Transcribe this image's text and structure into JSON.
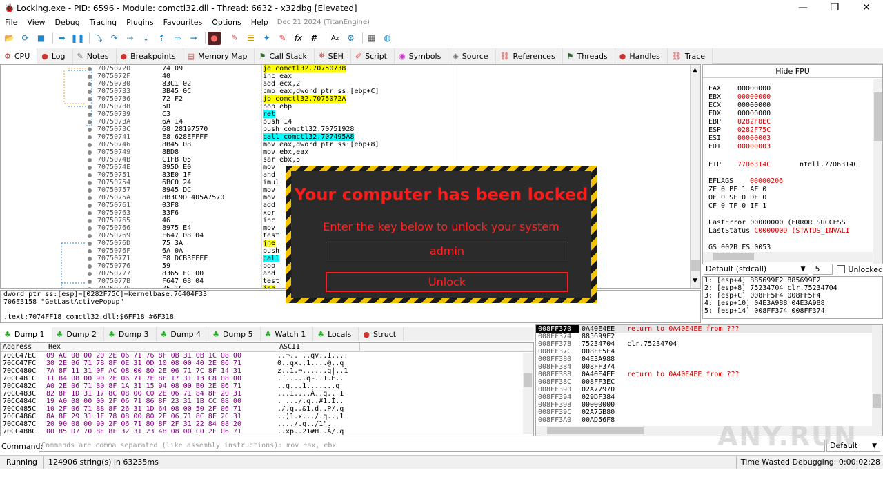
{
  "window": {
    "title": "Locking.exe - PID: 6596 - Module: comctl32.dll - Thread: 6632 - x32dbg [Elevated]",
    "min": "—",
    "max": "❐",
    "close": "✕"
  },
  "menu": {
    "items": [
      "File",
      "View",
      "Debug",
      "Tracing",
      "Plugins",
      "Favourites",
      "Options",
      "Help"
    ],
    "date": "Dec 21 2024 (TitanEngine)"
  },
  "tabs": [
    "CPU",
    "Log",
    "Notes",
    "Breakpoints",
    "Memory Map",
    "Call Stack",
    "SEH",
    "Script",
    "Symbols",
    "Source",
    "References",
    "Threads",
    "Handles",
    "Trace"
  ],
  "disasm": [
    {
      "addr": "70750720",
      "bytes": "74 09",
      "ins": "je comctl32.70750738",
      "hl": "y"
    },
    {
      "addr": "7075072F",
      "bytes": "40",
      "ins": "inc eax",
      "hl": ""
    },
    {
      "addr": "70750730",
      "bytes": "83C1 02",
      "ins": "add ecx,2",
      "hl": ""
    },
    {
      "addr": "70750733",
      "bytes": "3B45 0C",
      "ins": "cmp eax,dword ptr ss:[ebp+C]",
      "hl": ""
    },
    {
      "addr": "70750736",
      "bytes": "72 F2",
      "ins": "jb comctl32.7075072A",
      "hl": "y"
    },
    {
      "addr": "70750738",
      "bytes": "5D",
      "ins": "pop ebp",
      "hl": ""
    },
    {
      "addr": "70750739",
      "bytes": "C3",
      "ins": "ret",
      "hl": "c"
    },
    {
      "addr": "7075073A",
      "bytes": "6A 14",
      "ins": "push 14",
      "hl": ""
    },
    {
      "addr": "7075073C",
      "bytes": "68 28197570",
      "ins": "push comctl32.70751928",
      "hl": ""
    },
    {
      "addr": "70750741",
      "bytes": "E8 628EFFFF",
      "ins": "call comctl32.707495A8",
      "hl": "c"
    },
    {
      "addr": "70750746",
      "bytes": "8B45 08",
      "ins": "mov eax,dword ptr ss:[ebp+8]",
      "hl": ""
    },
    {
      "addr": "70750749",
      "bytes": "8BD8",
      "ins": "mov ebx,eax",
      "hl": ""
    },
    {
      "addr": "7075074B",
      "bytes": "C1FB 05",
      "ins": "sar ebx,5",
      "hl": ""
    },
    {
      "addr": "7075074E",
      "bytes": "895D E0",
      "ins": "mov",
      "hl": ""
    },
    {
      "addr": "70750751",
      "bytes": "83E0 1F",
      "ins": "and",
      "hl": ""
    },
    {
      "addr": "70750754",
      "bytes": "6BC0 24",
      "ins": "imul",
      "hl": ""
    },
    {
      "addr": "70750757",
      "bytes": "8945 DC",
      "ins": "mov",
      "hl": ""
    },
    {
      "addr": "7075075A",
      "bytes": "8B3C9D 405A7570",
      "ins": "mov",
      "hl": ""
    },
    {
      "addr": "70750761",
      "bytes": "03F8",
      "ins": "add",
      "hl": ""
    },
    {
      "addr": "70750763",
      "bytes": "33F6",
      "ins": "xor",
      "hl": ""
    },
    {
      "addr": "70750765",
      "bytes": "46",
      "ins": "inc",
      "hl": ""
    },
    {
      "addr": "70750766",
      "bytes": "8975 E4",
      "ins": "mov",
      "hl": ""
    },
    {
      "addr": "70750769",
      "bytes": "F647 08 04",
      "ins": "test",
      "hl": ""
    },
    {
      "addr": "7075076D",
      "bytes": "75 3A",
      "ins": "jne",
      "hl": "y"
    },
    {
      "addr": "7075076F",
      "bytes": "6A 0A",
      "ins": "push",
      "hl": ""
    },
    {
      "addr": "70750771",
      "bytes": "E8 DCB3FFFF",
      "ins": "call",
      "hl": "c"
    },
    {
      "addr": "70750776",
      "bytes": "59",
      "ins": "pop",
      "hl": ""
    },
    {
      "addr": "70750777",
      "bytes": "8365 FC 00",
      "ins": "and",
      "hl": ""
    },
    {
      "addr": "7075077B",
      "bytes": "F647 08 04",
      "ins": "test",
      "hl": ""
    },
    {
      "addr": "7075077F",
      "bytes": "75 1C",
      "ins": "jne",
      "hl": "y"
    }
  ],
  "registers": {
    "header": "Hide FPU",
    "gp": [
      {
        "n": "EAX",
        "v": "00000000",
        "red": false
      },
      {
        "n": "EBX",
        "v": "00000000",
        "red": true
      },
      {
        "n": "ECX",
        "v": "00000000",
        "red": false
      },
      {
        "n": "EDX",
        "v": "00000000",
        "red": false
      },
      {
        "n": "EBP",
        "v": "0282F8EC",
        "red": true
      },
      {
        "n": "ESP",
        "v": "0282F75C",
        "red": true
      },
      {
        "n": "ESI",
        "v": "00000003",
        "red": true
      },
      {
        "n": "EDI",
        "v": "00000003",
        "red": true
      }
    ],
    "eip": {
      "n": "EIP",
      "v": "77D6314C",
      "sym": "ntdll.77D6314C"
    },
    "eflags": {
      "n": "EFLAGS",
      "v": "00000206"
    },
    "flags1": "ZF 0  PF 1  AF 0",
    "flags2": "OF 0  SF 0  DF 0",
    "flags3": "CF 0  TF 0  IF 1",
    "lasterror": "LastError  00000000 (ERROR_SUCCESS",
    "laststatus_label": "LastStatus",
    "laststatus_val": "C000000D (STATUS_INVALI",
    "segs": "GS 002B  FS 0053"
  },
  "callconv": {
    "value": "Default (stdcall)",
    "count": "5",
    "unlocked": "Unlocked"
  },
  "stackargs": [
    "1: [esp+4]  885699F2 885699F2",
    "2: [esp+8]  75234704 clr.75234704",
    "3: [esp+C]  008FF5F4 008FF5F4",
    "4: [esp+10] 04E3A988 04E3A988",
    "5: [esp+14] 008FF374 008FF374"
  ],
  "info": {
    "line1": "dword ptr ss:[esp]=[0282F75C]=kernelbase.76404F33",
    "line2": "706E3158 \"GetLastActivePopup\"",
    "line3": ".text:7074FF18 comctl32.dll:$6FF18 #6F318"
  },
  "dumptabs": [
    "Dump 1",
    "Dump 2",
    "Dump 3",
    "Dump 4",
    "Dump 5",
    "Watch 1",
    "Locals",
    "Struct"
  ],
  "dump": {
    "headers": [
      "Address",
      "Hex",
      "ASCII"
    ],
    "rows": [
      {
        "a": "70CC47EC",
        "h": "09 AC 08 00 20 2E 06 71 76 8F 0B 31 0B 1C 08 00",
        "s": "..¬.. ..qv..1...."
      },
      {
        "a": "70CC47FC",
        "h": "30 2E 06 71 78 8F 0E 31 0D 10 08 00 40 2E 06 71",
        "s": "0..qx..1....@..q"
      },
      {
        "a": "70CC480C",
        "h": "7A 8F 11 31 0F AC 08 00 80 2E 06 71 7C 8F 14 31",
        "s": "z..1.¬......q|..1"
      },
      {
        "a": "70CC481C",
        "h": "11 B4 08 00 90 2E 06 71 7E 8F 17 31 13 C8 08 00",
        "s": ".´.....q~..1.È.."
      },
      {
        "a": "70CC482C",
        "h": "A0 2E 06 71 80 8F 1A 31 15 94 08 00 B0 2E 06 71",
        "s": " ..q...1.......q"
      },
      {
        "a": "70CC483C",
        "h": "82 8F 1D 31 17 8C 08 00 C0 2E 06 71 84 8F 20 31",
        "s": "...1....À..q.. 1"
      },
      {
        "a": "70CC484C",
        "h": "19 A0 08 00 00 2F 06 71 86 8F 23 31 1B CC 08 00",
        "s": ". .../.q..#1.Ì.."
      },
      {
        "a": "70CC485C",
        "h": "10 2F 06 71 88 8F 26 31 1D 64 08 00 50 2F 06 71",
        "s": "./.q..&1.d..P/.q"
      },
      {
        "a": "70CC486C",
        "h": "8A 8F 29 31 1F 78 08 00 80 2F 06 71 8C 8F 2C 31",
        "s": "..)1.x.../.q..,1"
      },
      {
        "a": "70CC487C",
        "h": "20 90 08 00 90 2F 06 71 80 8F 2F 31 22 84 08 20",
        "s": " ..../.q../1\". "
      },
      {
        "a": "70CC488C",
        "h": "00 85 D7 70 8E 8F 32 31 23 48 08 00 C0 2F 06 71",
        "s": "..xp..21#H..À/.q"
      }
    ]
  },
  "stack": [
    {
      "a": "008FF370",
      "v": "0A40E4EE",
      "c": "return to 0A40E4EE from ???",
      "red": true,
      "sel": true
    },
    {
      "a": "008FF374",
      "v": "885699F2",
      "c": "",
      "red": false,
      "sel": false
    },
    {
      "a": "008FF378",
      "v": "75234704",
      "c": "clr.75234704",
      "red": false,
      "sel": false
    },
    {
      "a": "008FF37C",
      "v": "008FF5F4",
      "c": "",
      "red": false,
      "sel": false
    },
    {
      "a": "008FF380",
      "v": "04E3A988",
      "c": "",
      "red": false,
      "sel": false
    },
    {
      "a": "008FF384",
      "v": "008FF374",
      "c": "",
      "red": false,
      "sel": false
    },
    {
      "a": "008FF388",
      "v": "0A40E4EE",
      "c": "return to 0A40E4EE from ???",
      "red": true,
      "sel": false
    },
    {
      "a": "008FF38C",
      "v": "008FF3EC",
      "c": "",
      "red": false,
      "sel": false
    },
    {
      "a": "008FF390",
      "v": "02A77970",
      "c": "",
      "red": false,
      "sel": false
    },
    {
      "a": "008FF394",
      "v": "029DF384",
      "c": "",
      "red": false,
      "sel": false
    },
    {
      "a": "008FF398",
      "v": "00000000",
      "c": "",
      "red": false,
      "sel": false
    },
    {
      "a": "008FF39C",
      "v": "02A75B80",
      "c": "",
      "red": false,
      "sel": false
    },
    {
      "a": "008FF3A0",
      "v": "00AD56F8",
      "c": "",
      "red": false,
      "sel": false
    }
  ],
  "command": {
    "label": "Command:",
    "placeholder": "Commands are comma separated (like assembly instructions): mov eax, ebx",
    "dropdown": "Default"
  },
  "status": {
    "state": "Running",
    "msg": "124906 string(s) in 63235ms",
    "time": "Time Wasted Debugging: 0:00:02:28"
  },
  "locker": {
    "title": "Your computer has been locked",
    "subtitle": "Enter the key below to unlock your system",
    "input": "admin",
    "button": "Unlock"
  },
  "watermark": "ANY.RUN"
}
